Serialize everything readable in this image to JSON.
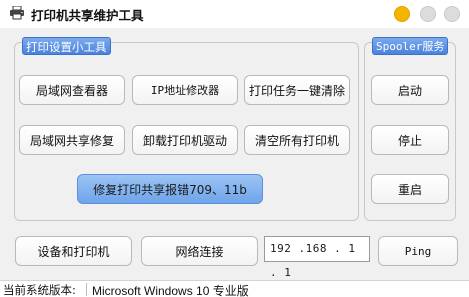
{
  "window": {
    "title": "打印机共享维护工具",
    "controls": {
      "minimize_color": "#f5b400",
      "maximize_color": "#dcdcdc",
      "close_color": "#dcdcdc"
    }
  },
  "tools_group": {
    "title": "打印设置小工具",
    "buttons": [
      "局域网查看器",
      "IP地址修改器",
      "打印任务一键清除",
      "局域网共享修复",
      "卸载打印机驱动",
      "清空所有打印机"
    ],
    "repair_button": "修复打印共享报错709、11b"
  },
  "spooler_group": {
    "title": "Spooler服务",
    "start": "启动",
    "stop": "停止",
    "restart": "重启"
  },
  "bottom": {
    "devices_printers": "设备和打印机",
    "network_connections": "网络连接",
    "ip_value": "192 .168 . 1  . 1",
    "ping": "Ping"
  },
  "status": {
    "label": "当前系统版本:",
    "value": "Microsoft Windows 10 专业版"
  },
  "colors": {
    "accent_blue": "#6ea4ea",
    "group_title_blue": "#4a83dc"
  }
}
